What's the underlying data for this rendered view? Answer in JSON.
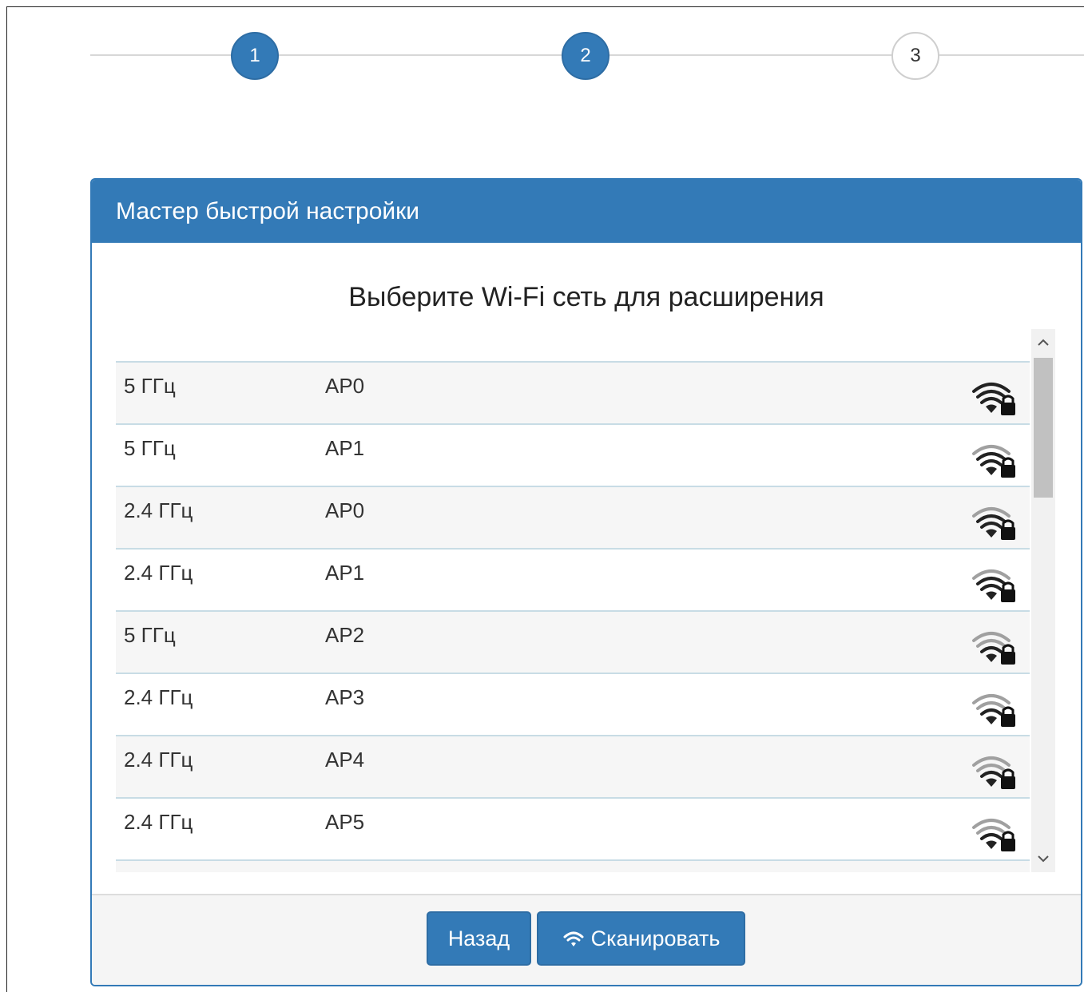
{
  "stepper": {
    "steps": [
      {
        "label": "1",
        "state": "active"
      },
      {
        "label": "2",
        "state": "active"
      },
      {
        "label": "3",
        "state": "pending"
      }
    ]
  },
  "panel": {
    "title": "Мастер быстрой настройки",
    "list_title": "Выберите Wi-Fi сеть для расширения"
  },
  "networks": [
    {
      "band": "5 ГГц",
      "ssid": "AP0",
      "icon": "wifi-lock-icon",
      "signal": 1.0
    },
    {
      "band": "5 ГГц",
      "ssid": "AP1",
      "icon": "wifi-lock-icon",
      "signal": 0.75
    },
    {
      "band": "2.4 ГГц",
      "ssid": "AP0",
      "icon": "wifi-lock-icon",
      "signal": 0.75
    },
    {
      "band": "2.4 ГГц",
      "ssid": "AP1",
      "icon": "wifi-lock-icon",
      "signal": 0.75
    },
    {
      "band": "5 ГГц",
      "ssid": "AP2",
      "icon": "wifi-lock-icon",
      "signal": 0.5
    },
    {
      "band": "2.4 ГГц",
      "ssid": "AP3",
      "icon": "wifi-lock-icon",
      "signal": 0.5
    },
    {
      "band": "2.4 ГГц",
      "ssid": "AP4",
      "icon": "wifi-lock-icon",
      "signal": 0.5
    },
    {
      "band": "2.4 ГГц",
      "ssid": "AP5",
      "icon": "wifi-lock-icon",
      "signal": 0.5
    }
  ],
  "footer": {
    "back_label": "Назад",
    "scan_label": "Сканировать",
    "scan_icon": "wifi-icon"
  },
  "colors": {
    "primary": "#337ab7",
    "signal_strong": "#222222",
    "signal_weak": "#a0a0a0"
  }
}
